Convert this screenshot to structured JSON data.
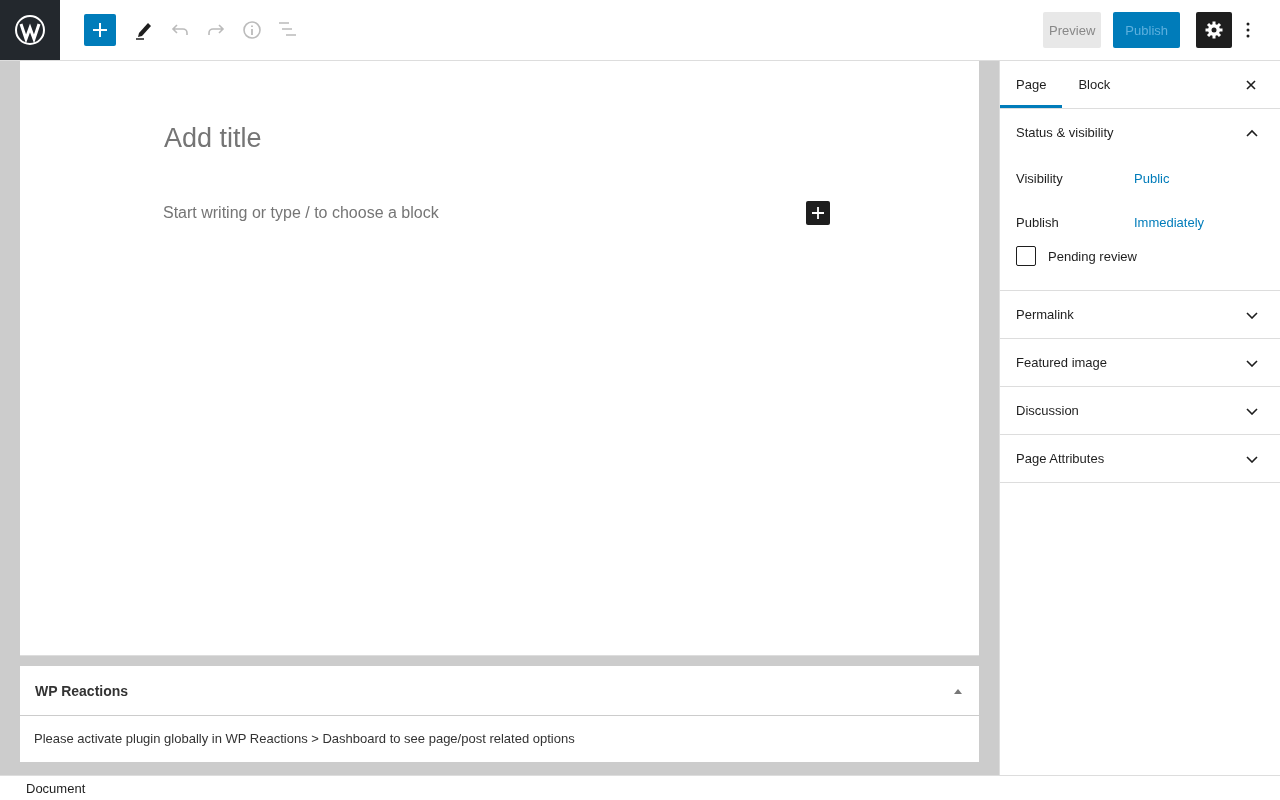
{
  "toolbar": {
    "preview": "Preview",
    "publish": "Publish"
  },
  "editor": {
    "title_placeholder": "Add title",
    "block_placeholder": "Start writing or type / to choose a block"
  },
  "metabox": {
    "title": "WP Reactions",
    "expanded": true,
    "message": "Please activate plugin globally in WP Reactions > Dashboard to see page/post related options"
  },
  "sidebar": {
    "tabs": [
      {
        "label": "Page",
        "selected": true
      },
      {
        "label": "Block",
        "selected": false
      }
    ],
    "panels": [
      {
        "title": "Status & visibility",
        "expanded": true,
        "rows": [
          {
            "label": "Visibility",
            "value": "Public"
          },
          {
            "label": "Publish",
            "value": "Immediately"
          }
        ],
        "checkbox": {
          "label": "Pending review",
          "checked": false
        }
      },
      {
        "title": "Permalink",
        "expanded": false
      },
      {
        "title": "Featured image",
        "expanded": false
      },
      {
        "title": "Discussion",
        "expanded": false
      },
      {
        "title": "Page Attributes",
        "expanded": false
      }
    ]
  },
  "status_bar": {
    "breadcrumb": "Document"
  }
}
